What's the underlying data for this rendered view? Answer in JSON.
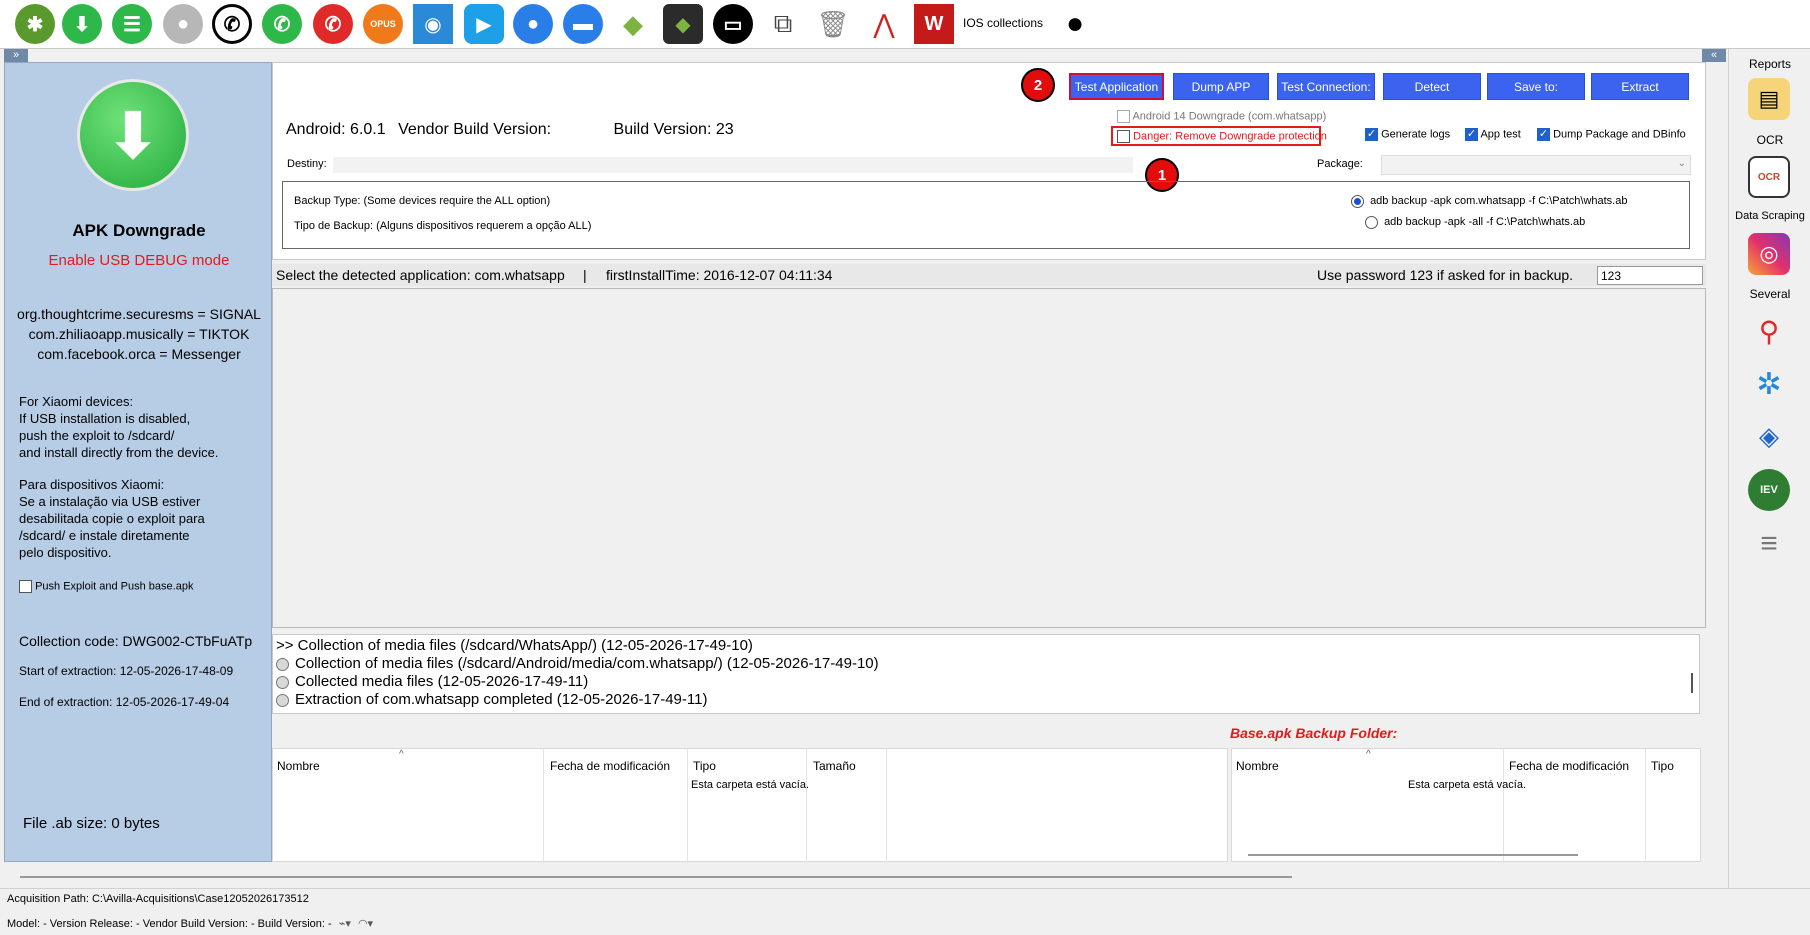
{
  "toolbar": {
    "ios_label": "IOS collections",
    "icons": [
      "android-bug-icon",
      "download-icon",
      "sms-icon",
      "contact-icon",
      "whatsapp-icon",
      "whatsapp-business-icon",
      "phone-icon",
      "opus-icon",
      "camera-icon",
      "video-icon",
      "user-icon",
      "chat-icon",
      "android-icon",
      "android-studio-icon",
      "folder-icon",
      "transfer-icon",
      "trash-icon",
      "graph-icon",
      "wordbook-icon",
      "apple-icon"
    ],
    "opus_label": "OPUS"
  },
  "left_panel": {
    "title": "APK Downgrade",
    "usb_debug": "Enable USB DEBUG mode",
    "packages": [
      "org.thoughtcrime.securesms = SIGNAL",
      "com.zhiliaoapp.musically = TIKTOK",
      "com.facebook.orca = Messenger"
    ],
    "xiaomi_en": [
      "For Xiaomi devices:",
      "If USB installation is disabled,",
      "push the exploit to /sdcard/",
      "and install directly from the device."
    ],
    "xiaomi_pt": [
      "Para dispositivos Xiaomi:",
      "Se a instalação via USB estiver",
      "desabilitada copie o exploit para",
      "/sdcard/ e instale diretamente",
      "pelo dispositivo."
    ],
    "push_exploit_label": "Push Exploit and Push base.apk",
    "collection_code": "Collection code: DWG002-CTbFuATp",
    "start_extraction": "Start of extraction: 12-05-2026-17-48-09",
    "end_extraction": "End of extraction: 12-05-2026-17-49-04",
    "file_size": "File .ab size: 0 bytes"
  },
  "actions": {
    "test_application": "Test Application",
    "dump_app": "Dump APP",
    "test_connection": "Test Connection:",
    "detect": "Detect",
    "save_to": "Save to:",
    "extract": "Extract",
    "badge_1": "1",
    "badge_2": "2"
  },
  "device": {
    "android_label": "Android:",
    "android_version": "6.0.1",
    "vendor_label": "Vendor Build Version:",
    "build_label": "Build Version:",
    "build_version": "23"
  },
  "options": {
    "android14": "Android 14 Downgrade (com.whatsapp)",
    "danger": "Danger: Remove Downgrade protection",
    "generate_logs": "Generate logs",
    "app_test": "App test",
    "dump_package": "Dump Package and DBinfo"
  },
  "destiny_label": "Destiny:",
  "package_label": "Package:",
  "backup": {
    "type_en": "Backup Type: (Some devices require the ALL option)",
    "type_pt": "Tipo de Backup: (Alguns dispositivos requerem a opção ALL)",
    "option_whatsapp": "adb backup -apk com.whatsapp -f C:\\Patch\\whats.ab",
    "option_all": "adb backup -apk -all -f C:\\Patch\\whats.ab"
  },
  "info_bar": {
    "detected": "Select the detected application: com.whatsapp",
    "separator": "|",
    "install_time": "firstInstallTime: 2016-12-07 04:11:34",
    "password_hint": "Use password 123 if asked for in backup.",
    "password_value": "123"
  },
  "log": [
    {
      "text": ">> Collection of media files (/sdcard/WhatsApp/) (12-05-2026-17-49-10)",
      "dot": false
    },
    {
      "text": "Collection of media files (/sdcard/Android/media/com.whatsapp/) (12-05-2026-17-49-10)",
      "dot": true
    },
    {
      "text": "Collected media files (12-05-2026-17-49-11)",
      "dot": true
    },
    {
      "text": "Extraction of com.whatsapp completed (12-05-2026-17-49-11)",
      "dot": true
    }
  ],
  "explorer_left": {
    "cols": [
      "Nombre",
      "Fecha de modificación",
      "Tipo",
      "Tamaño"
    ],
    "empty": "Esta carpeta está vacía."
  },
  "explorer_right": {
    "title": "Base.apk Backup Folder:",
    "cols": [
      "Nombre",
      "Fecha de modificación",
      "Tipo"
    ],
    "empty": "Esta carpeta está vacía."
  },
  "right_sidebar": {
    "reports": "Reports",
    "ocr": "OCR",
    "data_scraping": "Data Scraping",
    "several": "Several",
    "ocr_icon_text": "OCR",
    "iev_text": "IEV"
  },
  "status": {
    "acquisition_path": "Acquisition Path: C:\\Avilla-Acquisitions\\Case12052026173512",
    "model_line": "Model: -   Version Release: -   Vendor Build Version: -   Build Version: -"
  },
  "colors": {
    "accent_blue": "#3b63f0",
    "left_panel_bg": "#b7cde5",
    "danger_red": "#e20c0c",
    "green": "#2fb84a"
  }
}
